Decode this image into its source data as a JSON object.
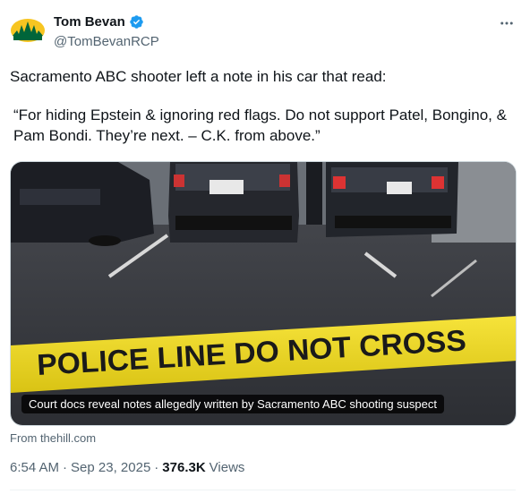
{
  "author": {
    "name": "Tom Bevan",
    "handle": "@TomBevanRCP",
    "avatar_icon": "sonics-logo-icon",
    "verified_icon": "verified-badge-icon",
    "verified_color": "#1d9bf0"
  },
  "more_icon": "more-options-icon",
  "tweet": {
    "line1": "Sacramento ABC shooter left a note in his car that read:",
    "line2": "“For hiding Epstein & ignoring red flags. Do not support Patel, Bongino, & Pam Bondi. They’re next. – C.K. from above.”"
  },
  "media": {
    "image_text": "POLICE LINE DO NOT CROSS",
    "caption": "Court docs reveal notes allegedly written by Sacramento ABC shooting suspect",
    "source": "From thehill.com"
  },
  "meta": {
    "time": "6:54 AM",
    "sep1": "·",
    "date": "Sep 23, 2025",
    "sep2": "·",
    "views_count": "376.3K",
    "views_label": "Views"
  },
  "colors": {
    "text": "#0f1419",
    "secondary": "#536471",
    "tape": "#f2dc1e"
  }
}
